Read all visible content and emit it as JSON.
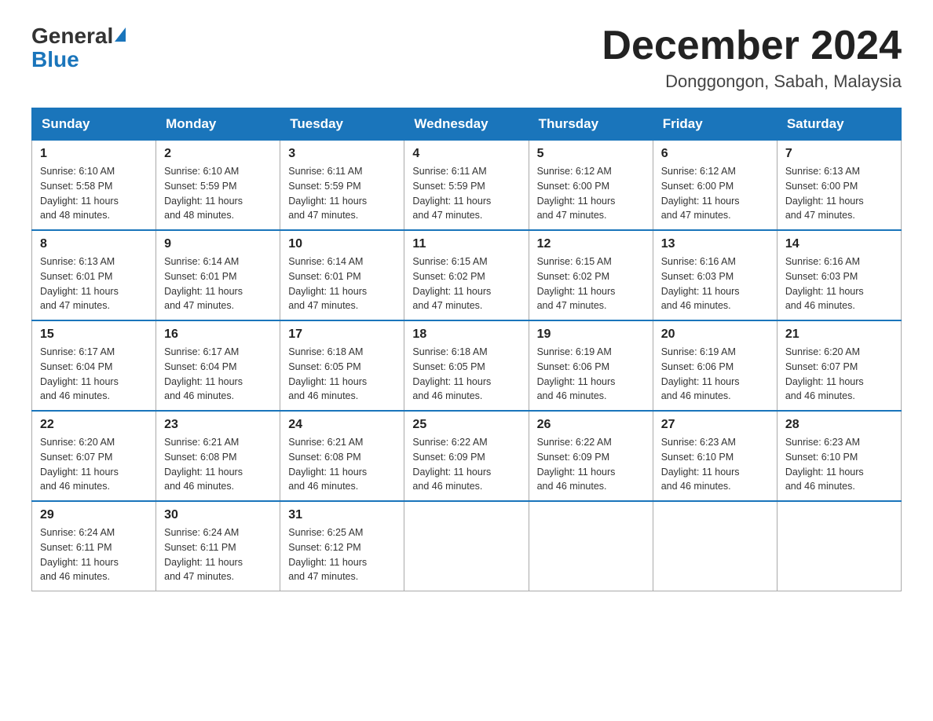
{
  "logo": {
    "general": "General",
    "blue": "Blue",
    "arrow_color": "#1a75bb"
  },
  "title": {
    "month": "December 2024",
    "location": "Donggongon, Sabah, Malaysia"
  },
  "header_color": "#1a75bb",
  "days_of_week": [
    "Sunday",
    "Monday",
    "Tuesday",
    "Wednesday",
    "Thursday",
    "Friday",
    "Saturday"
  ],
  "weeks": [
    {
      "days": [
        {
          "num": "1",
          "sunrise": "6:10 AM",
          "sunset": "5:58 PM",
          "daylight": "11 hours and 48 minutes."
        },
        {
          "num": "2",
          "sunrise": "6:10 AM",
          "sunset": "5:59 PM",
          "daylight": "11 hours and 48 minutes."
        },
        {
          "num": "3",
          "sunrise": "6:11 AM",
          "sunset": "5:59 PM",
          "daylight": "11 hours and 47 minutes."
        },
        {
          "num": "4",
          "sunrise": "6:11 AM",
          "sunset": "5:59 PM",
          "daylight": "11 hours and 47 minutes."
        },
        {
          "num": "5",
          "sunrise": "6:12 AM",
          "sunset": "6:00 PM",
          "daylight": "11 hours and 47 minutes."
        },
        {
          "num": "6",
          "sunrise": "6:12 AM",
          "sunset": "6:00 PM",
          "daylight": "11 hours and 47 minutes."
        },
        {
          "num": "7",
          "sunrise": "6:13 AM",
          "sunset": "6:00 PM",
          "daylight": "11 hours and 47 minutes."
        }
      ]
    },
    {
      "days": [
        {
          "num": "8",
          "sunrise": "6:13 AM",
          "sunset": "6:01 PM",
          "daylight": "11 hours and 47 minutes."
        },
        {
          "num": "9",
          "sunrise": "6:14 AM",
          "sunset": "6:01 PM",
          "daylight": "11 hours and 47 minutes."
        },
        {
          "num": "10",
          "sunrise": "6:14 AM",
          "sunset": "6:01 PM",
          "daylight": "11 hours and 47 minutes."
        },
        {
          "num": "11",
          "sunrise": "6:15 AM",
          "sunset": "6:02 PM",
          "daylight": "11 hours and 47 minutes."
        },
        {
          "num": "12",
          "sunrise": "6:15 AM",
          "sunset": "6:02 PM",
          "daylight": "11 hours and 47 minutes."
        },
        {
          "num": "13",
          "sunrise": "6:16 AM",
          "sunset": "6:03 PM",
          "daylight": "11 hours and 46 minutes."
        },
        {
          "num": "14",
          "sunrise": "6:16 AM",
          "sunset": "6:03 PM",
          "daylight": "11 hours and 46 minutes."
        }
      ]
    },
    {
      "days": [
        {
          "num": "15",
          "sunrise": "6:17 AM",
          "sunset": "6:04 PM",
          "daylight": "11 hours and 46 minutes."
        },
        {
          "num": "16",
          "sunrise": "6:17 AM",
          "sunset": "6:04 PM",
          "daylight": "11 hours and 46 minutes."
        },
        {
          "num": "17",
          "sunrise": "6:18 AM",
          "sunset": "6:05 PM",
          "daylight": "11 hours and 46 minutes."
        },
        {
          "num": "18",
          "sunrise": "6:18 AM",
          "sunset": "6:05 PM",
          "daylight": "11 hours and 46 minutes."
        },
        {
          "num": "19",
          "sunrise": "6:19 AM",
          "sunset": "6:06 PM",
          "daylight": "11 hours and 46 minutes."
        },
        {
          "num": "20",
          "sunrise": "6:19 AM",
          "sunset": "6:06 PM",
          "daylight": "11 hours and 46 minutes."
        },
        {
          "num": "21",
          "sunrise": "6:20 AM",
          "sunset": "6:07 PM",
          "daylight": "11 hours and 46 minutes."
        }
      ]
    },
    {
      "days": [
        {
          "num": "22",
          "sunrise": "6:20 AM",
          "sunset": "6:07 PM",
          "daylight": "11 hours and 46 minutes."
        },
        {
          "num": "23",
          "sunrise": "6:21 AM",
          "sunset": "6:08 PM",
          "daylight": "11 hours and 46 minutes."
        },
        {
          "num": "24",
          "sunrise": "6:21 AM",
          "sunset": "6:08 PM",
          "daylight": "11 hours and 46 minutes."
        },
        {
          "num": "25",
          "sunrise": "6:22 AM",
          "sunset": "6:09 PM",
          "daylight": "11 hours and 46 minutes."
        },
        {
          "num": "26",
          "sunrise": "6:22 AM",
          "sunset": "6:09 PM",
          "daylight": "11 hours and 46 minutes."
        },
        {
          "num": "27",
          "sunrise": "6:23 AM",
          "sunset": "6:10 PM",
          "daylight": "11 hours and 46 minutes."
        },
        {
          "num": "28",
          "sunrise": "6:23 AM",
          "sunset": "6:10 PM",
          "daylight": "11 hours and 46 minutes."
        }
      ]
    },
    {
      "days": [
        {
          "num": "29",
          "sunrise": "6:24 AM",
          "sunset": "6:11 PM",
          "daylight": "11 hours and 46 minutes."
        },
        {
          "num": "30",
          "sunrise": "6:24 AM",
          "sunset": "6:11 PM",
          "daylight": "11 hours and 47 minutes."
        },
        {
          "num": "31",
          "sunrise": "6:25 AM",
          "sunset": "6:12 PM",
          "daylight": "11 hours and 47 minutes."
        },
        null,
        null,
        null,
        null
      ]
    }
  ]
}
